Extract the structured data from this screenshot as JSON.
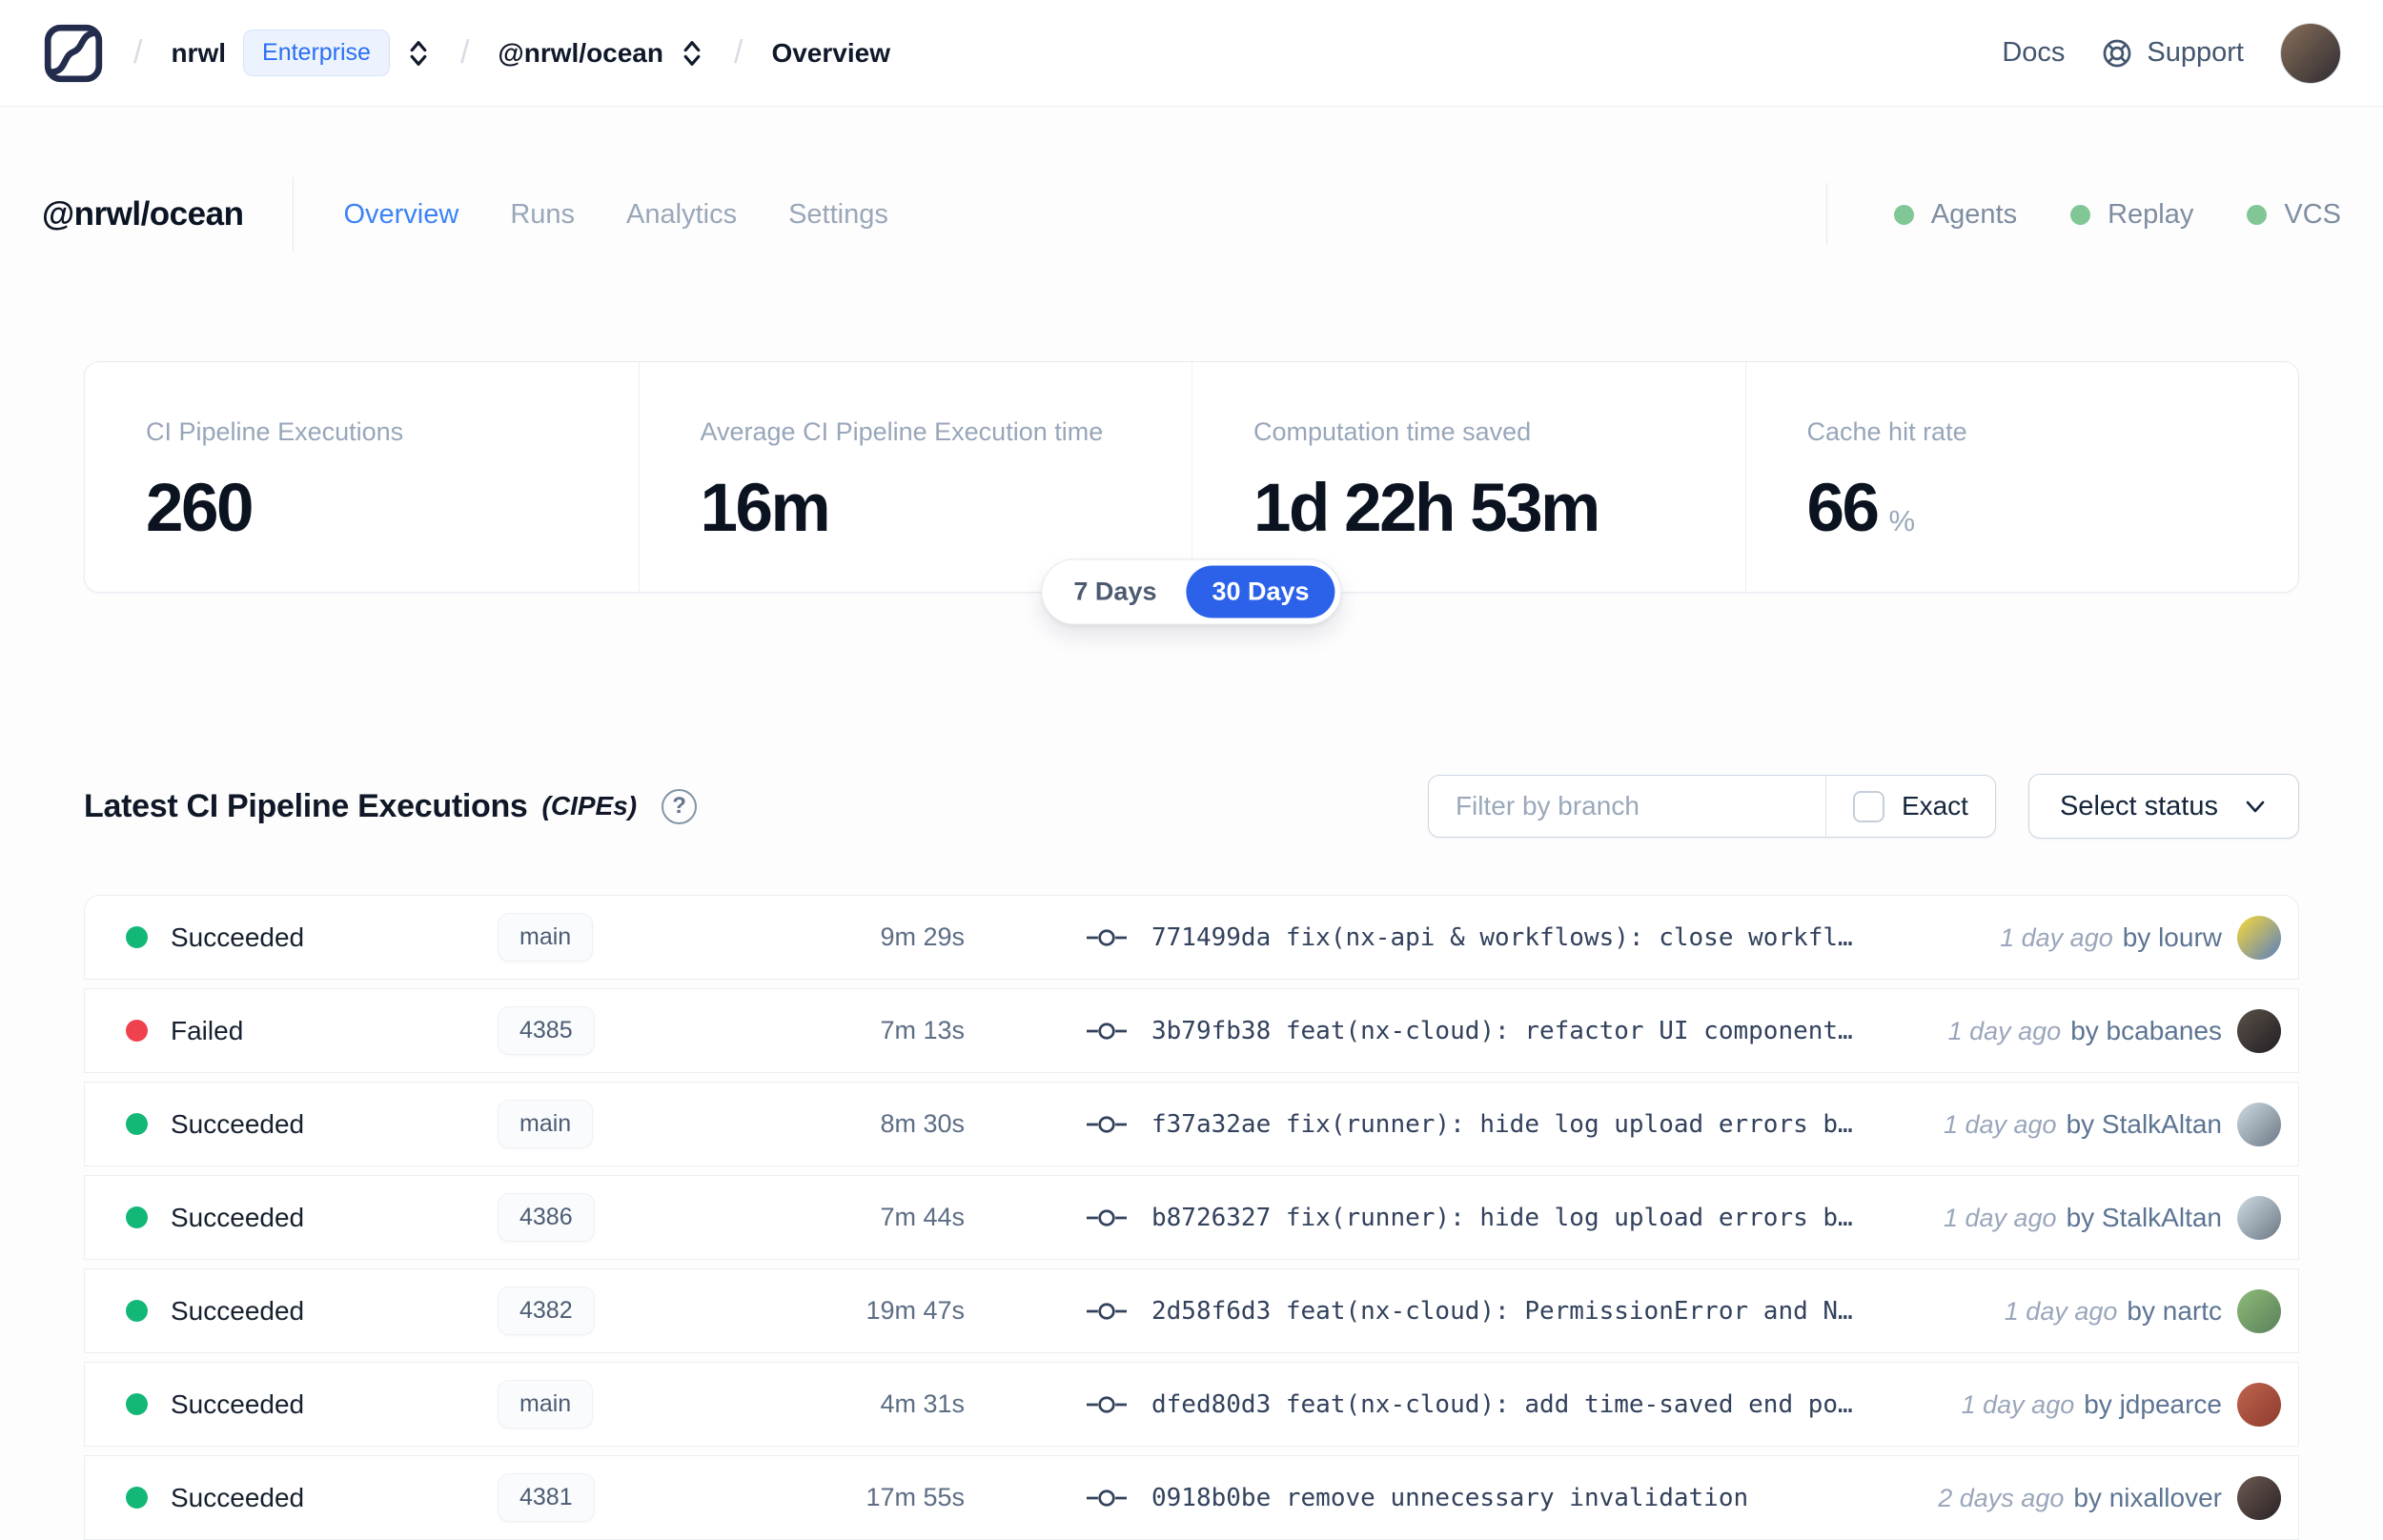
{
  "nav": {
    "separator": "/",
    "breadcrumb": {
      "org": "nrwl",
      "badge": "Enterprise",
      "workspace": "@nrwl/ocean",
      "page": "Overview"
    },
    "links": {
      "docs": "Docs",
      "support": "Support"
    },
    "avatar_colors": [
      "#8a6f5a",
      "#2e2c31"
    ]
  },
  "header": {
    "title": "@nrwl/ocean",
    "tabs": [
      {
        "label": "Overview",
        "active": true
      },
      {
        "label": "Runs",
        "active": false
      },
      {
        "label": "Analytics",
        "active": false
      },
      {
        "label": "Settings",
        "active": false
      }
    ],
    "statuses": [
      {
        "label": "Agents",
        "color": "#80c795"
      },
      {
        "label": "Replay",
        "color": "#80c795"
      },
      {
        "label": "VCS",
        "color": "#80c795"
      }
    ]
  },
  "stats": {
    "cards": [
      {
        "label": "CI Pipeline Executions",
        "value": "260"
      },
      {
        "label": "Average CI Pipeline Execution time",
        "value": "16m"
      },
      {
        "label": "Computation time saved",
        "value": "1d 22h 53m"
      },
      {
        "label": "Cache hit rate",
        "value": "66",
        "suffix": "%"
      }
    ],
    "range_toggle": [
      {
        "label": "7 Days",
        "active": false
      },
      {
        "label": "30 Days",
        "active": true
      }
    ],
    "accent_color": "#2c62ea"
  },
  "cipes": {
    "title": "Latest CI Pipeline Executions",
    "title_suffix": "(CIPEs)",
    "help_glyph": "?",
    "filter": {
      "placeholder": "Filter by branch",
      "exact_label": "Exact",
      "exact_checked": false,
      "status_label": "Select status"
    },
    "status_colors": {
      "green": "#13b877",
      "red": "#f0414e"
    },
    "rows": [
      {
        "status": "Succeeded",
        "status_color": "green",
        "branch": "main",
        "duration": "9m 29s",
        "commit": "771499da fix(nx-api & workflows): close workfl…",
        "time": "1 day ago",
        "author": "by lourw",
        "avatar": [
          "#f8d839",
          "#5a7fc0"
        ]
      },
      {
        "status": "Failed",
        "status_color": "red",
        "branch": "4385",
        "duration": "7m 13s",
        "commit": "3b79fb38 feat(nx-cloud): refactor UI component…",
        "time": "1 day ago",
        "author": "by bcabanes",
        "avatar": [
          "#5b5148",
          "#221f24"
        ]
      },
      {
        "status": "Succeeded",
        "status_color": "green",
        "branch": "main",
        "duration": "8m 30s",
        "commit": "f37a32ae fix(runner): hide log upload errors b…",
        "time": "1 day ago",
        "author": "by StalkAltan",
        "avatar": [
          "#cfdbe2",
          "#6b7884"
        ]
      },
      {
        "status": "Succeeded",
        "status_color": "green",
        "branch": "4386",
        "duration": "7m 44s",
        "commit": "b8726327 fix(runner): hide log upload errors b…",
        "time": "1 day ago",
        "author": "by StalkAltan",
        "avatar": [
          "#cfdbe2",
          "#6b7884"
        ]
      },
      {
        "status": "Succeeded",
        "status_color": "green",
        "branch": "4382",
        "duration": "19m 47s",
        "commit": "2d58f6d3 feat(nx-cloud): PermissionError and N…",
        "time": "1 day ago",
        "author": "by nartc",
        "avatar": [
          "#8fbb79",
          "#58815a"
        ]
      },
      {
        "status": "Succeeded",
        "status_color": "green",
        "branch": "main",
        "duration": "4m 31s",
        "commit": "dfed80d3 feat(nx-cloud): add time-saved end po…",
        "time": "1 day ago",
        "author": "by jdpearce",
        "avatar": [
          "#c0654f",
          "#8e3a2e"
        ]
      },
      {
        "status": "Succeeded",
        "status_color": "green",
        "branch": "4381",
        "duration": "17m 55s",
        "commit": "0918b0be remove unnecessary invalidation",
        "time": "2 days ago",
        "author": "by nixallover",
        "avatar": [
          "#6e5a52",
          "#2a2226"
        ]
      }
    ]
  }
}
